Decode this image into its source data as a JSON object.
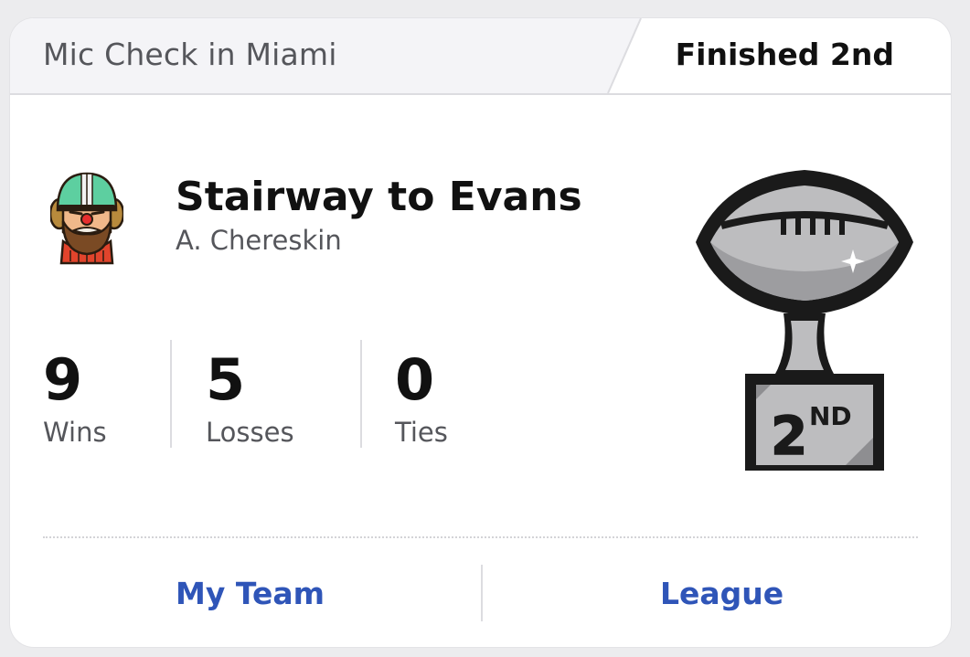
{
  "header": {
    "league_name": "Mic Check in Miami",
    "finish": "Finished 2nd"
  },
  "team": {
    "name": "Stairway to Evans",
    "owner": "A. Chereskin",
    "avatar_icon": "bearded-football-player-avatar-icon"
  },
  "stats": [
    {
      "value": "9",
      "label": "Wins"
    },
    {
      "value": "5",
      "label": "Losses"
    },
    {
      "value": "0",
      "label": "Ties"
    }
  ],
  "trophy": {
    "icon": "second-place-trophy-icon",
    "place_number": "2",
    "place_suffix": "ND"
  },
  "footer": {
    "my_team": "My Team",
    "league": "League"
  },
  "colors": {
    "link": "#2f55b8",
    "header_bg": "#f4f4f7",
    "text_primary": "#111111",
    "text_secondary": "#55565b"
  }
}
